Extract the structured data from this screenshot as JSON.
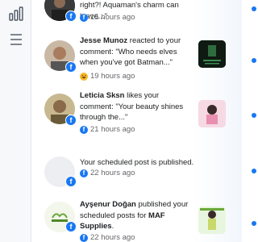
{
  "rail": {
    "insights_icon": "bar-chart-icon",
    "menu_icon": "hamburger-menu-icon"
  },
  "notifications": [
    {
      "text_tail": "right?! Aquaman's charm can leave...\"",
      "time": "15 hours ago",
      "meta_icon": "facebook-icon"
    },
    {
      "actor": "Jesse Munoz",
      "text": " reacted to your comment: \"Who needs elves when you've got Batman...\"",
      "time": "19 hours ago",
      "meta_icon": "haha-emoji-icon"
    },
    {
      "actor": "Leticia Sksn",
      "text": " likes your comment: \"Your beauty shines through the...\"",
      "time": "21 hours ago",
      "meta_icon": "facebook-icon"
    },
    {
      "text": "Your scheduled post is published.",
      "time": "22 hours ago",
      "meta_icon": "facebook-icon"
    },
    {
      "actor": "Ayşenur Doğan",
      "text_mid": " published your scheduled posts for ",
      "page": "MAF Supplies",
      "text_end": ".",
      "time": "22 hours ago",
      "meta_icon": "facebook-icon"
    }
  ],
  "colors": {
    "accent": "#1877f2",
    "unread_dot": "#1877f2",
    "meta_text": "#65676b"
  }
}
